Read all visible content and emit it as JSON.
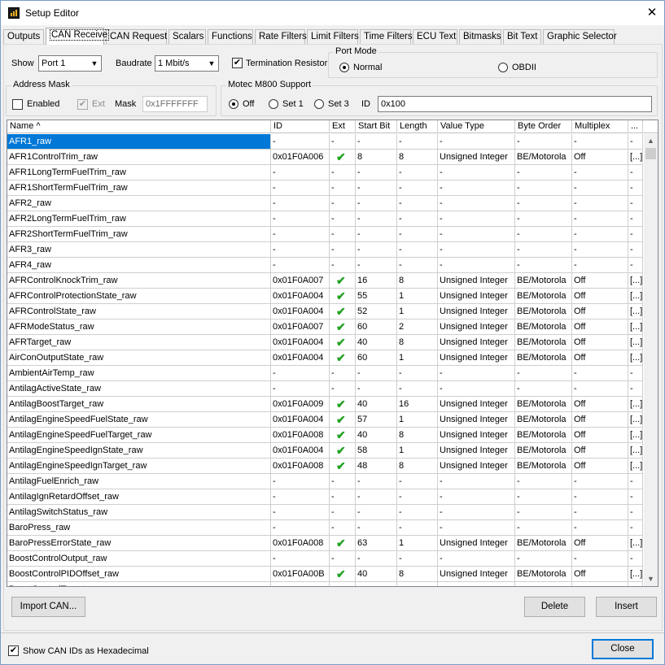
{
  "window": {
    "title": "Setup Editor",
    "close_glyph": "✕"
  },
  "tabs": [
    "Outputs",
    "CAN Receive",
    "CAN Request",
    "Scalars",
    "Functions",
    "Rate Filters",
    "Limit Filters",
    "Time Filters",
    "ECU Text",
    "Bitmasks",
    "Bit Text",
    "Graphic Selector"
  ],
  "active_tab": "CAN Receive",
  "port": {
    "label": "Show",
    "value": "Port 1"
  },
  "baudrate": {
    "label": "Baudrate",
    "value": "1 Mbit/s"
  },
  "termination": {
    "label": "Termination Resistor",
    "checked": true
  },
  "port_mode": {
    "title": "Port Mode",
    "normal": "Normal",
    "obdii": "OBDII",
    "selected": "Normal"
  },
  "address_mask": {
    "title": "Address Mask",
    "enabled_label": "Enabled",
    "ext_label": "Ext",
    "mask_label": "Mask",
    "mask_value": "0x1FFFFFFF"
  },
  "motec": {
    "title": "Motec M800 Support",
    "off": "Off",
    "set1": "Set 1",
    "set3": "Set 3",
    "id_label": "ID",
    "id_value": "0x100",
    "selected": "Off"
  },
  "grid": {
    "columns": [
      "Name ^",
      "ID",
      "Ext",
      "Start Bit",
      "Length",
      "Value Type",
      "Byte Order",
      "Multiplex",
      "..."
    ],
    "rows": [
      [
        "AFR1_raw",
        "-",
        "-",
        "-",
        "-",
        "-",
        "-",
        "-",
        "-"
      ],
      [
        "AFR1ControlTrim_raw",
        "0x01F0A006",
        "✔",
        "8",
        "8",
        "Unsigned Integer",
        "BE/Motorola",
        "Off",
        "[...]"
      ],
      [
        "AFR1LongTermFuelTrim_raw",
        "-",
        "-",
        "-",
        "-",
        "-",
        "-",
        "-",
        "-"
      ],
      [
        "AFR1ShortTermFuelTrim_raw",
        "-",
        "-",
        "-",
        "-",
        "-",
        "-",
        "-",
        "-"
      ],
      [
        "AFR2_raw",
        "-",
        "-",
        "-",
        "-",
        "-",
        "-",
        "-",
        "-"
      ],
      [
        "AFR2LongTermFuelTrim_raw",
        "-",
        "-",
        "-",
        "-",
        "-",
        "-",
        "-",
        "-"
      ],
      [
        "AFR2ShortTermFuelTrim_raw",
        "-",
        "-",
        "-",
        "-",
        "-",
        "-",
        "-",
        "-"
      ],
      [
        "AFR3_raw",
        "-",
        "-",
        "-",
        "-",
        "-",
        "-",
        "-",
        "-"
      ],
      [
        "AFR4_raw",
        "-",
        "-",
        "-",
        "-",
        "-",
        "-",
        "-",
        "-"
      ],
      [
        "AFRControlKnockTrim_raw",
        "0x01F0A007",
        "✔",
        "16",
        "8",
        "Unsigned Integer",
        "BE/Motorola",
        "Off",
        "[...]"
      ],
      [
        "AFRControlProtectionState_raw",
        "0x01F0A004",
        "✔",
        "55",
        "1",
        "Unsigned Integer",
        "BE/Motorola",
        "Off",
        "[...]"
      ],
      [
        "AFRControlState_raw",
        "0x01F0A004",
        "✔",
        "52",
        "1",
        "Unsigned Integer",
        "BE/Motorola",
        "Off",
        "[...]"
      ],
      [
        "AFRModeStatus_raw",
        "0x01F0A007",
        "✔",
        "60",
        "2",
        "Unsigned Integer",
        "BE/Motorola",
        "Off",
        "[...]"
      ],
      [
        "AFRTarget_raw",
        "0x01F0A004",
        "✔",
        "40",
        "8",
        "Unsigned Integer",
        "BE/Motorola",
        "Off",
        "[...]"
      ],
      [
        "AirConOutputState_raw",
        "0x01F0A004",
        "✔",
        "60",
        "1",
        "Unsigned Integer",
        "BE/Motorola",
        "Off",
        "[...]"
      ],
      [
        "AmbientAirTemp_raw",
        "-",
        "-",
        "-",
        "-",
        "-",
        "-",
        "-",
        "-"
      ],
      [
        "AntilagActiveState_raw",
        "-",
        "-",
        "-",
        "-",
        "-",
        "-",
        "-",
        "-"
      ],
      [
        "AntilagBoostTarget_raw",
        "0x01F0A009",
        "✔",
        "40",
        "16",
        "Unsigned Integer",
        "BE/Motorola",
        "Off",
        "[...]"
      ],
      [
        "AntilagEngineSpeedFuelState_raw",
        "0x01F0A004",
        "✔",
        "57",
        "1",
        "Unsigned Integer",
        "BE/Motorola",
        "Off",
        "[...]"
      ],
      [
        "AntilagEngineSpeedFuelTarget_raw",
        "0x01F0A008",
        "✔",
        "40",
        "8",
        "Unsigned Integer",
        "BE/Motorola",
        "Off",
        "[...]"
      ],
      [
        "AntilagEngineSpeedIgnState_raw",
        "0x01F0A004",
        "✔",
        "58",
        "1",
        "Unsigned Integer",
        "BE/Motorola",
        "Off",
        "[...]"
      ],
      [
        "AntilagEngineSpeedIgnTarget_raw",
        "0x01F0A008",
        "✔",
        "48",
        "8",
        "Unsigned Integer",
        "BE/Motorola",
        "Off",
        "[...]"
      ],
      [
        "AntilagFuelEnrich_raw",
        "-",
        "-",
        "-",
        "-",
        "-",
        "-",
        "-",
        "-"
      ],
      [
        "AntilagIgnRetardOffset_raw",
        "-",
        "-",
        "-",
        "-",
        "-",
        "-",
        "-",
        "-"
      ],
      [
        "AntilagSwitchStatus_raw",
        "-",
        "-",
        "-",
        "-",
        "-",
        "-",
        "-",
        "-"
      ],
      [
        "BaroPress_raw",
        "-",
        "-",
        "-",
        "-",
        "-",
        "-",
        "-",
        "-"
      ],
      [
        "BaroPressErrorState_raw",
        "0x01F0A008",
        "✔",
        "63",
        "1",
        "Unsigned Integer",
        "BE/Motorola",
        "Off",
        "[...]"
      ],
      [
        "BoostControlOutput_raw",
        "-",
        "-",
        "-",
        "-",
        "-",
        "-",
        "-",
        "-"
      ],
      [
        "BoostControlPIDOffset_raw",
        "0x01F0A00B",
        "✔",
        "40",
        "8",
        "Unsigned Integer",
        "BE/Motorola",
        "Off",
        "[...]"
      ],
      [
        "BoostControlTarget_raw",
        "-",
        "-",
        "-",
        "-",
        "-",
        "-",
        "-",
        "-"
      ]
    ]
  },
  "buttons": {
    "import": "Import CAN...",
    "delete": "Delete",
    "insert": "Insert",
    "close": "Close"
  },
  "show_hex": {
    "label": "Show CAN IDs as Hexadecimal",
    "checked": true
  },
  "colors": {
    "selection": "#0078d7",
    "tick": "#21a221",
    "window_bg": "#f0f0f0"
  },
  "icons": {
    "check": "✔",
    "scroll_up": "▲",
    "scroll_down": "▼",
    "dropdown": "▼"
  }
}
